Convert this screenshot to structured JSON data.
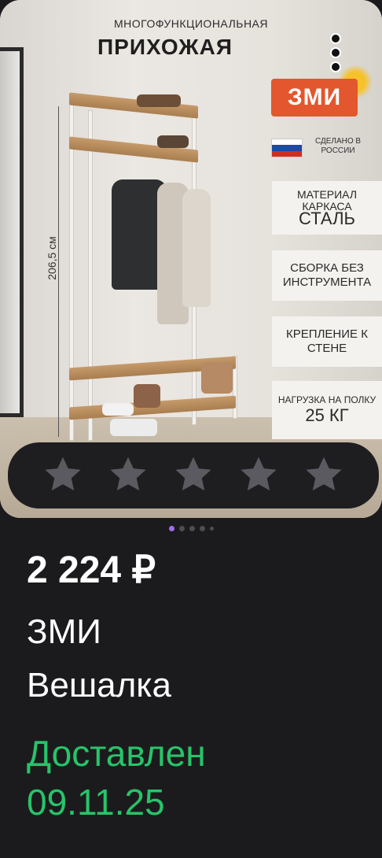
{
  "promo": {
    "subtitle": "МНОГОФУНКЦИОНАЛЬНАЯ",
    "title": "ПРИХОЖАЯ",
    "logo_text": "ЗМИ",
    "made_in": "СДЕЛАНО В РОССИИ",
    "dimension": "206,5 см",
    "features": {
      "material_label": "МАТЕРИАЛ КАРКАСА",
      "material_value": "СТАЛЬ",
      "assembly": "СБОРКА БЕЗ ИНСТРУМЕНТА",
      "mount": "КРЕПЛЕНИЕ К СТЕНЕ",
      "load_label": "НАГРУЗКА НА ПОЛКУ",
      "load_value": "25 КГ"
    }
  },
  "rating": {
    "stars_total": 5,
    "stars_filled": 0,
    "star_color": "#5a5a60"
  },
  "carousel": {
    "count": 5,
    "active": 0
  },
  "product": {
    "price": "2 224 ₽",
    "brand": "ЗМИ",
    "name": "Вешалка",
    "status_line1": "Доставлен",
    "status_line2": "09.11.25",
    "status_color": "#27c46a"
  },
  "icons": {
    "more": "more-vertical-icon",
    "star": "star-icon"
  }
}
